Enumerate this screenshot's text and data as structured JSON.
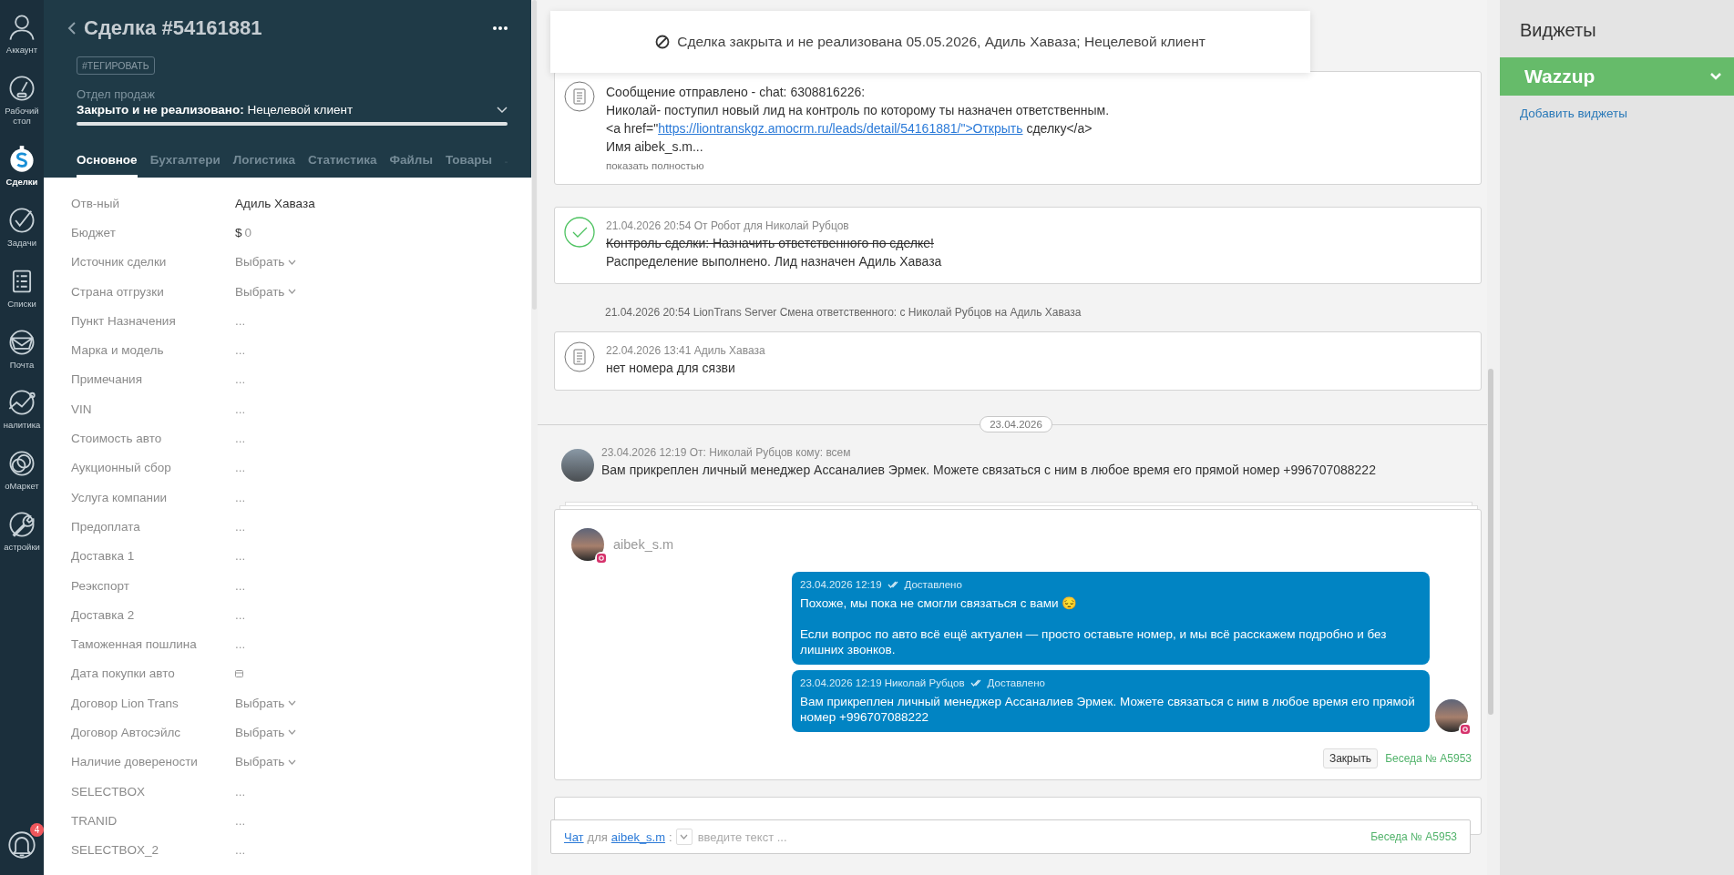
{
  "nav": {
    "items": [
      {
        "label": "Аккаунт",
        "selected": false
      },
      {
        "label": "Рабочий стол",
        "selected": false
      },
      {
        "label": "Сделки",
        "selected": true
      },
      {
        "label": "Задачи",
        "selected": false
      },
      {
        "label": "Списки",
        "selected": false
      },
      {
        "label": "Почта",
        "selected": false
      },
      {
        "label": "налитика",
        "selected": false
      },
      {
        "label": "оМаркет",
        "selected": false
      },
      {
        "label": "астройки",
        "selected": false
      }
    ],
    "notifications": {
      "badge": "4"
    }
  },
  "deal": {
    "title": "Сделка #54161881",
    "tag_button": "#ТЕГИРОВАТЬ",
    "pipeline": "Отдел продаж",
    "status": "Закрыто и не реализовано:",
    "reason": "Нецелевой клиент",
    "level": 1,
    "tabs": [
      {
        "label": "Основное",
        "selected": true
      },
      {
        "label": "Бухгалтери",
        "selected": false
      },
      {
        "label": "Логистика",
        "selected": false
      },
      {
        "label": "Статистика",
        "selected": false
      },
      {
        "label": "Файлы",
        "selected": false
      },
      {
        "label": "Товары",
        "selected": false
      }
    ],
    "fields": [
      {
        "label": "Отв-ный",
        "kind": "text",
        "value": "Адиль Хаваза"
      },
      {
        "label": "Бюджет",
        "kind": "money",
        "currency": "$",
        "value": "0"
      },
      {
        "label": "Источник сделки",
        "kind": "select",
        "placeholder": "Выбрать"
      },
      {
        "label": "Страна отгрузки",
        "kind": "select",
        "placeholder": "Выбрать"
      },
      {
        "label": "Пункт Назначения",
        "kind": "empty",
        "placeholder": "..."
      },
      {
        "label": "Марка и модель",
        "kind": "empty",
        "placeholder": "..."
      },
      {
        "label": "Примечания",
        "kind": "empty",
        "placeholder": "..."
      },
      {
        "label": "VIN",
        "kind": "empty",
        "placeholder": "..."
      },
      {
        "label": "Стоимость авто",
        "kind": "empty",
        "placeholder": "..."
      },
      {
        "label": "Аукционный сбор",
        "kind": "empty",
        "placeholder": "..."
      },
      {
        "label": "Услуга компании",
        "kind": "empty",
        "placeholder": "..."
      },
      {
        "label": "Предоплата",
        "kind": "empty",
        "placeholder": "..."
      },
      {
        "label": "Доставка 1",
        "kind": "empty",
        "placeholder": "..."
      },
      {
        "label": "Реэкспорт",
        "kind": "empty",
        "placeholder": "..."
      },
      {
        "label": "Доставка 2",
        "kind": "empty",
        "placeholder": "..."
      },
      {
        "label": "Таможенная пошлина",
        "kind": "empty",
        "placeholder": "..."
      },
      {
        "label": "Дата покупки авто",
        "kind": "date"
      },
      {
        "label": "Договор Lion Trans",
        "kind": "select",
        "placeholder": "Выбрать"
      },
      {
        "label": "Договор Автосэйлс",
        "kind": "select",
        "placeholder": "Выбрать"
      },
      {
        "label": "Наличие доверености",
        "kind": "select",
        "placeholder": "Выбрать"
      },
      {
        "label": "SELECTBOX",
        "kind": "empty",
        "placeholder": "..."
      },
      {
        "label": "TRANID",
        "kind": "empty",
        "placeholder": "..."
      },
      {
        "label": "SELECTBOX_2",
        "kind": "empty",
        "placeholder": "..."
      }
    ]
  },
  "timeline": {
    "banner": "Сделка закрыта и не реализована 05.05.2026, Адиль Хаваза; Нецелевой клиент",
    "items": [
      {
        "kind": "note",
        "lines": [
          "Сообщение отправлено - chat: 6308816226:",
          "Николай- поступил новый лид на контроль по которому ты назначен ответственным."
        ],
        "link_before": "<a href=\"",
        "link": "https://liontranskgz.amocrm.ru/leads/detail/54161881/\">Открыть",
        "link_after": " сделку</a>",
        "last_line": "Имя aibek_s.m...",
        "expand": "показать полностью"
      },
      {
        "kind": "task",
        "completed": true,
        "meta": "21.04.2026 20:54  От Робот для Николай Рубцов",
        "task": "Контроль сделки: Назначить ответственного по сделке!",
        "result": "Распределение выполнено. Лид назначен Адиль Хаваза"
      },
      {
        "kind": "system",
        "text": "21.04.2026 20:54 LionTrans Server Смена ответственного: с Николай Рубцов на Адиль Хаваза"
      },
      {
        "kind": "comment",
        "meta": "22.04.2026 13:41 Адиль Хаваза",
        "text": "нет номера для сязви"
      },
      {
        "kind": "date",
        "text": "23.04.2026"
      },
      {
        "kind": "message",
        "meta": "23.04.2026 12:19 От: Николай Рубцов кому: всем",
        "text": "Вам прикреплен личный менеджер Ассаналиев Эрмек. Можете связаться с ним в любое время его прямой номер +996707088222"
      }
    ],
    "chat": {
      "contact": "aibek_s.m",
      "messages": [
        {
          "meta": "23.04.2026 12:19",
          "status": "Доставлено",
          "paragraphs": [
            "Похоже, мы пока не смогли связаться с вами 😔",
            "Если вопрос по авто всё ещё актуален — просто оставьте номер, и мы всё расскажем подробно и без лишних звонков."
          ]
        },
        {
          "meta": "23.04.2026 12:19 Николай Рубцов",
          "status": "Доставлено",
          "paragraphs": [
            "Вам прикреплен личный менеджер Ассаналиев Эрмек. Можете связаться с ним в любое время его прямой номер +996707088222"
          ]
        }
      ],
      "close_button": "Закрыть",
      "conversation": "Беседа № A5953"
    },
    "composer": {
      "channel": "Чат",
      "for": "для",
      "contact": "aibek_s.m",
      "colon": ":",
      "placeholder": "введите текст ...",
      "conversation": "Беседа № A5953"
    }
  },
  "widgets": {
    "title": "Виджеты",
    "items": [
      {
        "name": "Wazzup"
      }
    ],
    "add_link": "Добавить виджеты"
  }
}
